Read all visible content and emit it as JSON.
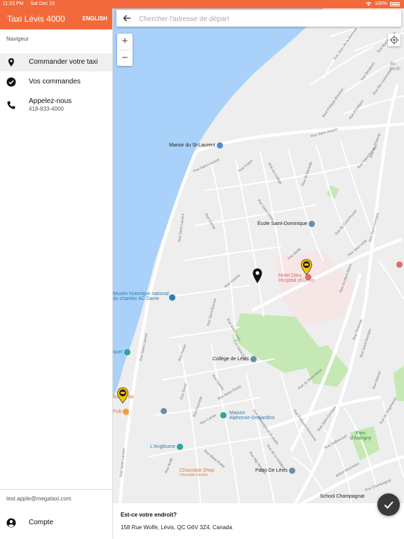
{
  "status_bar": {
    "time": "11:23 PM",
    "date": "Sat Dec 15",
    "battery": "100%"
  },
  "sidebar": {
    "app_title": "Taxi Lévis 4000",
    "language_button": "ENGLISH",
    "section_label": "Navigeur",
    "items": [
      {
        "label": "Commander votre taxi",
        "icon": "location-pin-icon"
      },
      {
        "label": "Vos commandes",
        "icon": "check-circle-icon"
      },
      {
        "label": "Appelez-nous",
        "sublabel": "418-833-4000",
        "icon": "phone-icon"
      }
    ],
    "footer": {
      "email": "test.apple@megataxi.com",
      "account_label": "Compte",
      "account_icon": "account-circle-icon"
    }
  },
  "search": {
    "placeholder": "Chercher l'adresse de départ"
  },
  "map": {
    "zoom_in": "+",
    "zoom_out": "−",
    "places": {
      "manoir": "Manoir du St-Laurent",
      "ecole": "École Saint-Dominique",
      "hotel_dieu": "Hotel Dieu",
      "hospital": "Hospital of Lévis",
      "musee_1": "Musée historique national",
      "musee_2": "du chantier AC Davie",
      "college": "Collège de Lévis",
      "maison_1": "Maison",
      "maison_2": "Alphonse-Desjardins",
      "anglicane": "L'Anglicane",
      "chocolate": "Chocolate Shop",
      "chocolate_sub": "Chocolats Favoris",
      "patro": "Patro De Lévis",
      "parc_1": "Parc",
      "parc_2": "d'Aubigny",
      "school_champagnat": "School Champagnat",
      "pub": "Pub",
      "multi": "Multi",
      "bo": "Bo",
      "quet": "quet",
      "ba": "Ba",
      "ba_end": "ba"
    },
    "streets": {
      "rue_saint_laurent_1": "Rue Saint-Laurent",
      "rue_saint_laurent_2": "Rue Saint-Laurent",
      "rue_saint_laurent_3": "Rue Saint-Laurent",
      "rue_saint_laurent_4": "Rue Saint-Laurent",
      "rue_saint_joseph": "Rue Saint-Joseph",
      "rue_de_lentente": "Rue de l'Entente",
      "rue_saint_georges_1": "Rue Saint-Georges",
      "rue_saint_georges_2": "Rue Saint-Georges",
      "rue_saint_georges_3": "Rue Saint-Georges",
      "rue_du_mont_marie": "Rue du Mont-Marie",
      "rue_champagnat": "Rue Champagnat",
      "rue_wolfe": "Rue Wolfe",
      "rue_victoria": "Rue Victoria",
      "rue_fraser": "Rue Fraser",
      "rue_carrier": "Rue Carrier",
      "rue_de_bienville": "Rue de Bienville",
      "rue_du_cure_peyrier": "Rue du Curé-Peyrier",
      "rue_jean_xxiii": "Rue Jean-XXIII",
      "boul_philippe_boucher": "Boul Philippe-Boucher",
      "rue_dorlean": "Rue D'Orléans",
      "rue_des_laurentides": "Rue des Laurentides",
      "rue_saint_omer": "Rue Saint-Omer",
      "rue_du_college": "Rue du Collège",
      "rue_eduard_rousseau": "Rue Édouard-Rousseau",
      "rue_des_mondrais": "Rue Monseigneur-Gosselin",
      "rue_dubois": "Rue Dubois",
      "rue_de_la_visitation": "Rue de la Visitation",
      "rue_mgr_bourget": "Rue Mgr-Bourget",
      "rue_notre_dame": "Rue Notre-Dame",
      "rue_marie_rollet": "Rue Marie-Rollet",
      "rue_duval": "Rue Duval",
      "rue_saint_etienne": "Rue Saint-Étienne",
      "rue_de_lesperance": "Rue de l'Espérance",
      "rue_mercier": "Rue Mercier",
      "rue_vaillancourt": "Rue Vaillancourt",
      "arthur_rousseau": "Arthur-Rousseau",
      "rue_saint_antoine": "Rue Saint-Antoine",
      "rue_bergeron": "Rue Bergeron",
      "rue_thivierge": "Rue Thivierge",
      "rue_saint_felix": "Rue Saint-Félix",
      "rue_saint_louis": "Rue Saint-Louis",
      "rue_jean_de_la_mennais": "Rue Jean-de-la-Mennais",
      "rue_bon_pasteur": "Rue Bon-Pasteur",
      "rue_guenette": "Rue Guenette"
    }
  },
  "bottom_panel": {
    "question": "Est-ce votre endroit?",
    "address": "158 Rue Wolfe, Lévis, QC G6V 3Z4, Canada",
    "confirm_icon": "check-icon"
  },
  "colors": {
    "brand": "#f26a3b",
    "water": "#a9d1f9",
    "park": "#c6e8b4",
    "hospital_area": "#f6e6e6",
    "taxi_marker": "#f7c600",
    "fab": "#3a3a3a"
  }
}
